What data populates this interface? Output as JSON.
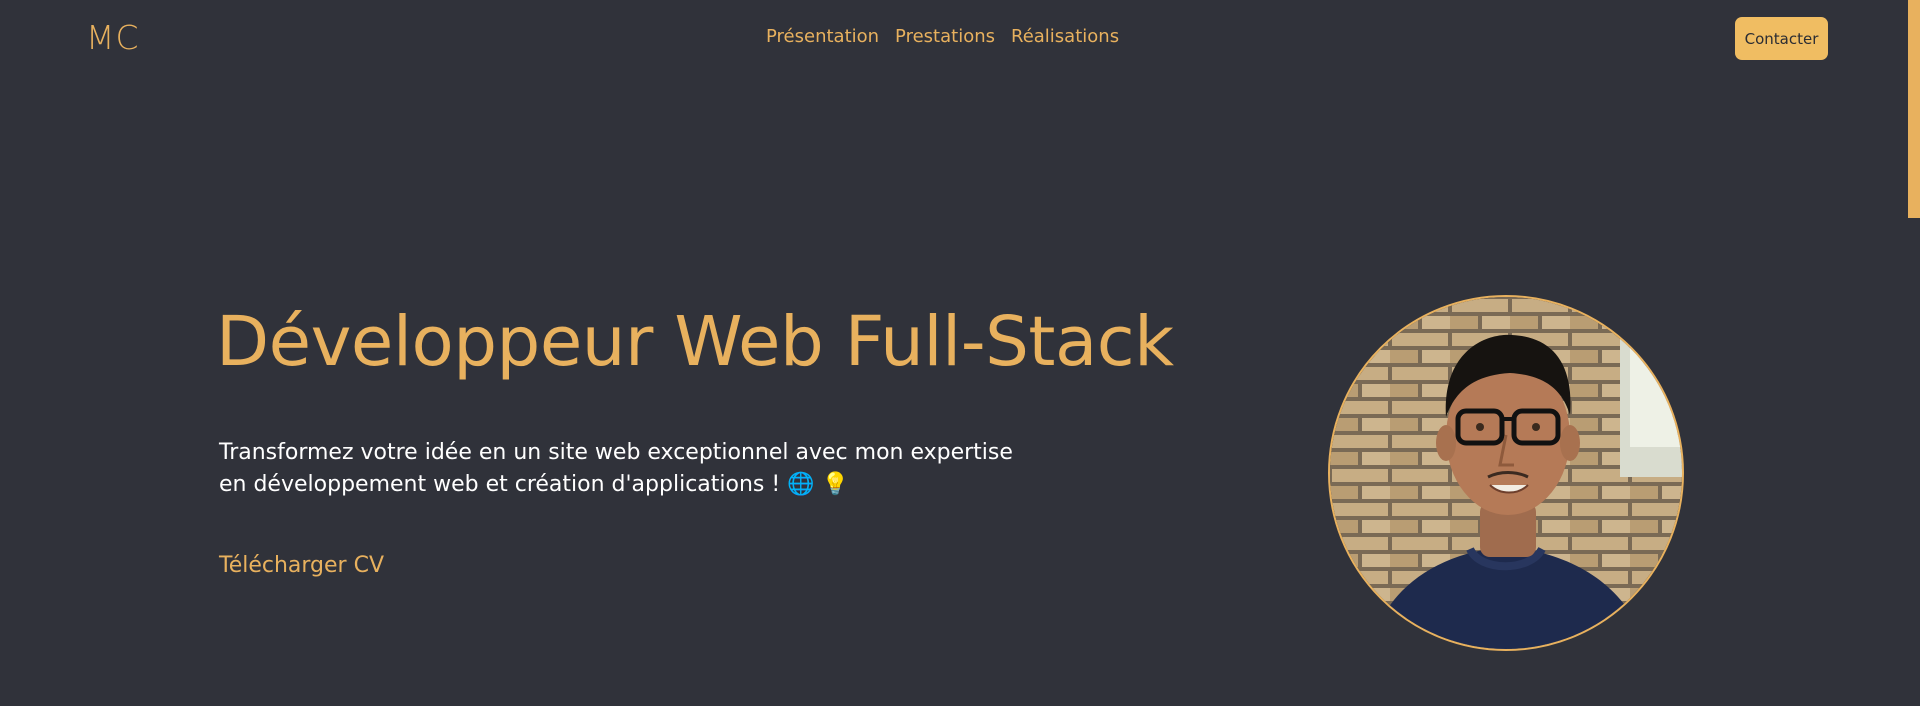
{
  "header": {
    "logo": "MC",
    "nav": [
      {
        "label": "Présentation"
      },
      {
        "label": "Prestations"
      },
      {
        "label": "Réalisations"
      }
    ],
    "contact_label": "Contacter"
  },
  "hero": {
    "title": "Développeur Web Full-Stack",
    "description_line1": "Transformez votre idée en un site web exceptionnel avec mon expertise",
    "description_line2": "en développement web et création d'applications ! 🌐 💡",
    "download_label": "Télécharger CV"
  },
  "colors": {
    "background": "#30323a",
    "accent": "#e8b15e",
    "button": "#f0bd62",
    "text": "#ffffff"
  },
  "icons": {
    "globe": "globe-icon",
    "bulb": "lightbulb-icon"
  }
}
